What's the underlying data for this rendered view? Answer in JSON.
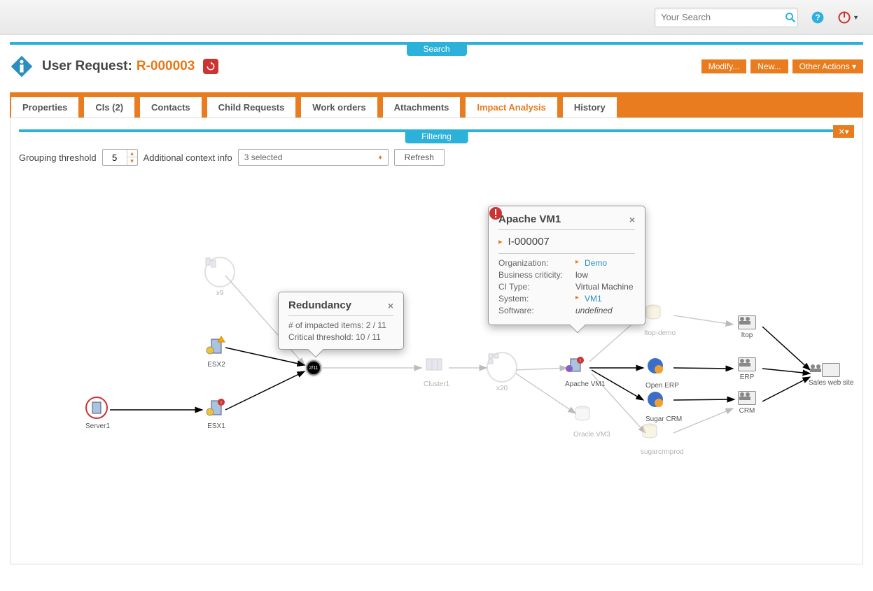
{
  "topbar": {
    "search_placeholder": "Your Search"
  },
  "bluebar": {
    "search_label": "Search",
    "filtering_label": "Filtering"
  },
  "header": {
    "title_prefix": "User Request:",
    "request_id": "R-000003"
  },
  "actions": {
    "modify": "Modify...",
    "new": "New...",
    "other": "Other Actions"
  },
  "tabs": [
    {
      "label": "Properties"
    },
    {
      "label": "CIs (2)"
    },
    {
      "label": "Contacts"
    },
    {
      "label": "Child Requests"
    },
    {
      "label": "Work orders"
    },
    {
      "label": "Attachments"
    },
    {
      "label": "Impact Analysis",
      "active": true
    },
    {
      "label": "History"
    }
  ],
  "filter": {
    "grouping_label": "Grouping threshold",
    "grouping_value": "5",
    "context_label": "Additional context info",
    "context_value": "3 selected",
    "refresh_label": "Refresh"
  },
  "tooltips": {
    "redundancy": {
      "title": "Redundancy",
      "impacted": "# of impacted items: 2 / 11",
      "critical": "Critical threshold: 10 / 11"
    },
    "apache": {
      "title": "Apache VM1",
      "incident_id": "I-000007",
      "rows": [
        {
          "k": "Organization:",
          "v": "Demo",
          "link": true
        },
        {
          "k": "Business criticity:",
          "v": "low"
        },
        {
          "k": "CI Type:",
          "v": "Virtual Machine"
        },
        {
          "k": "System:",
          "v": "VM1",
          "link": true
        },
        {
          "k": "Software:",
          "v": "undefined",
          "italic": true
        }
      ]
    }
  },
  "nodes": {
    "server1": "Server1",
    "esx1": "ESX1",
    "esx2": "ESX2",
    "group9": "x9",
    "redund": "2/11",
    "cluster1": "Cluster1",
    "group20": "x20",
    "apache": "Apache VM1",
    "oraclevm3": "Oracle VM3",
    "itopdemo": "Itop-demo",
    "openerp": "Open ERP",
    "sugarcrm": "Sugar CRM",
    "sugarcrmprod": "sugarcrmprod",
    "itop": "Itop",
    "erp": "ERP",
    "crm": "CRM",
    "saleswebsite": "Sales web site"
  }
}
